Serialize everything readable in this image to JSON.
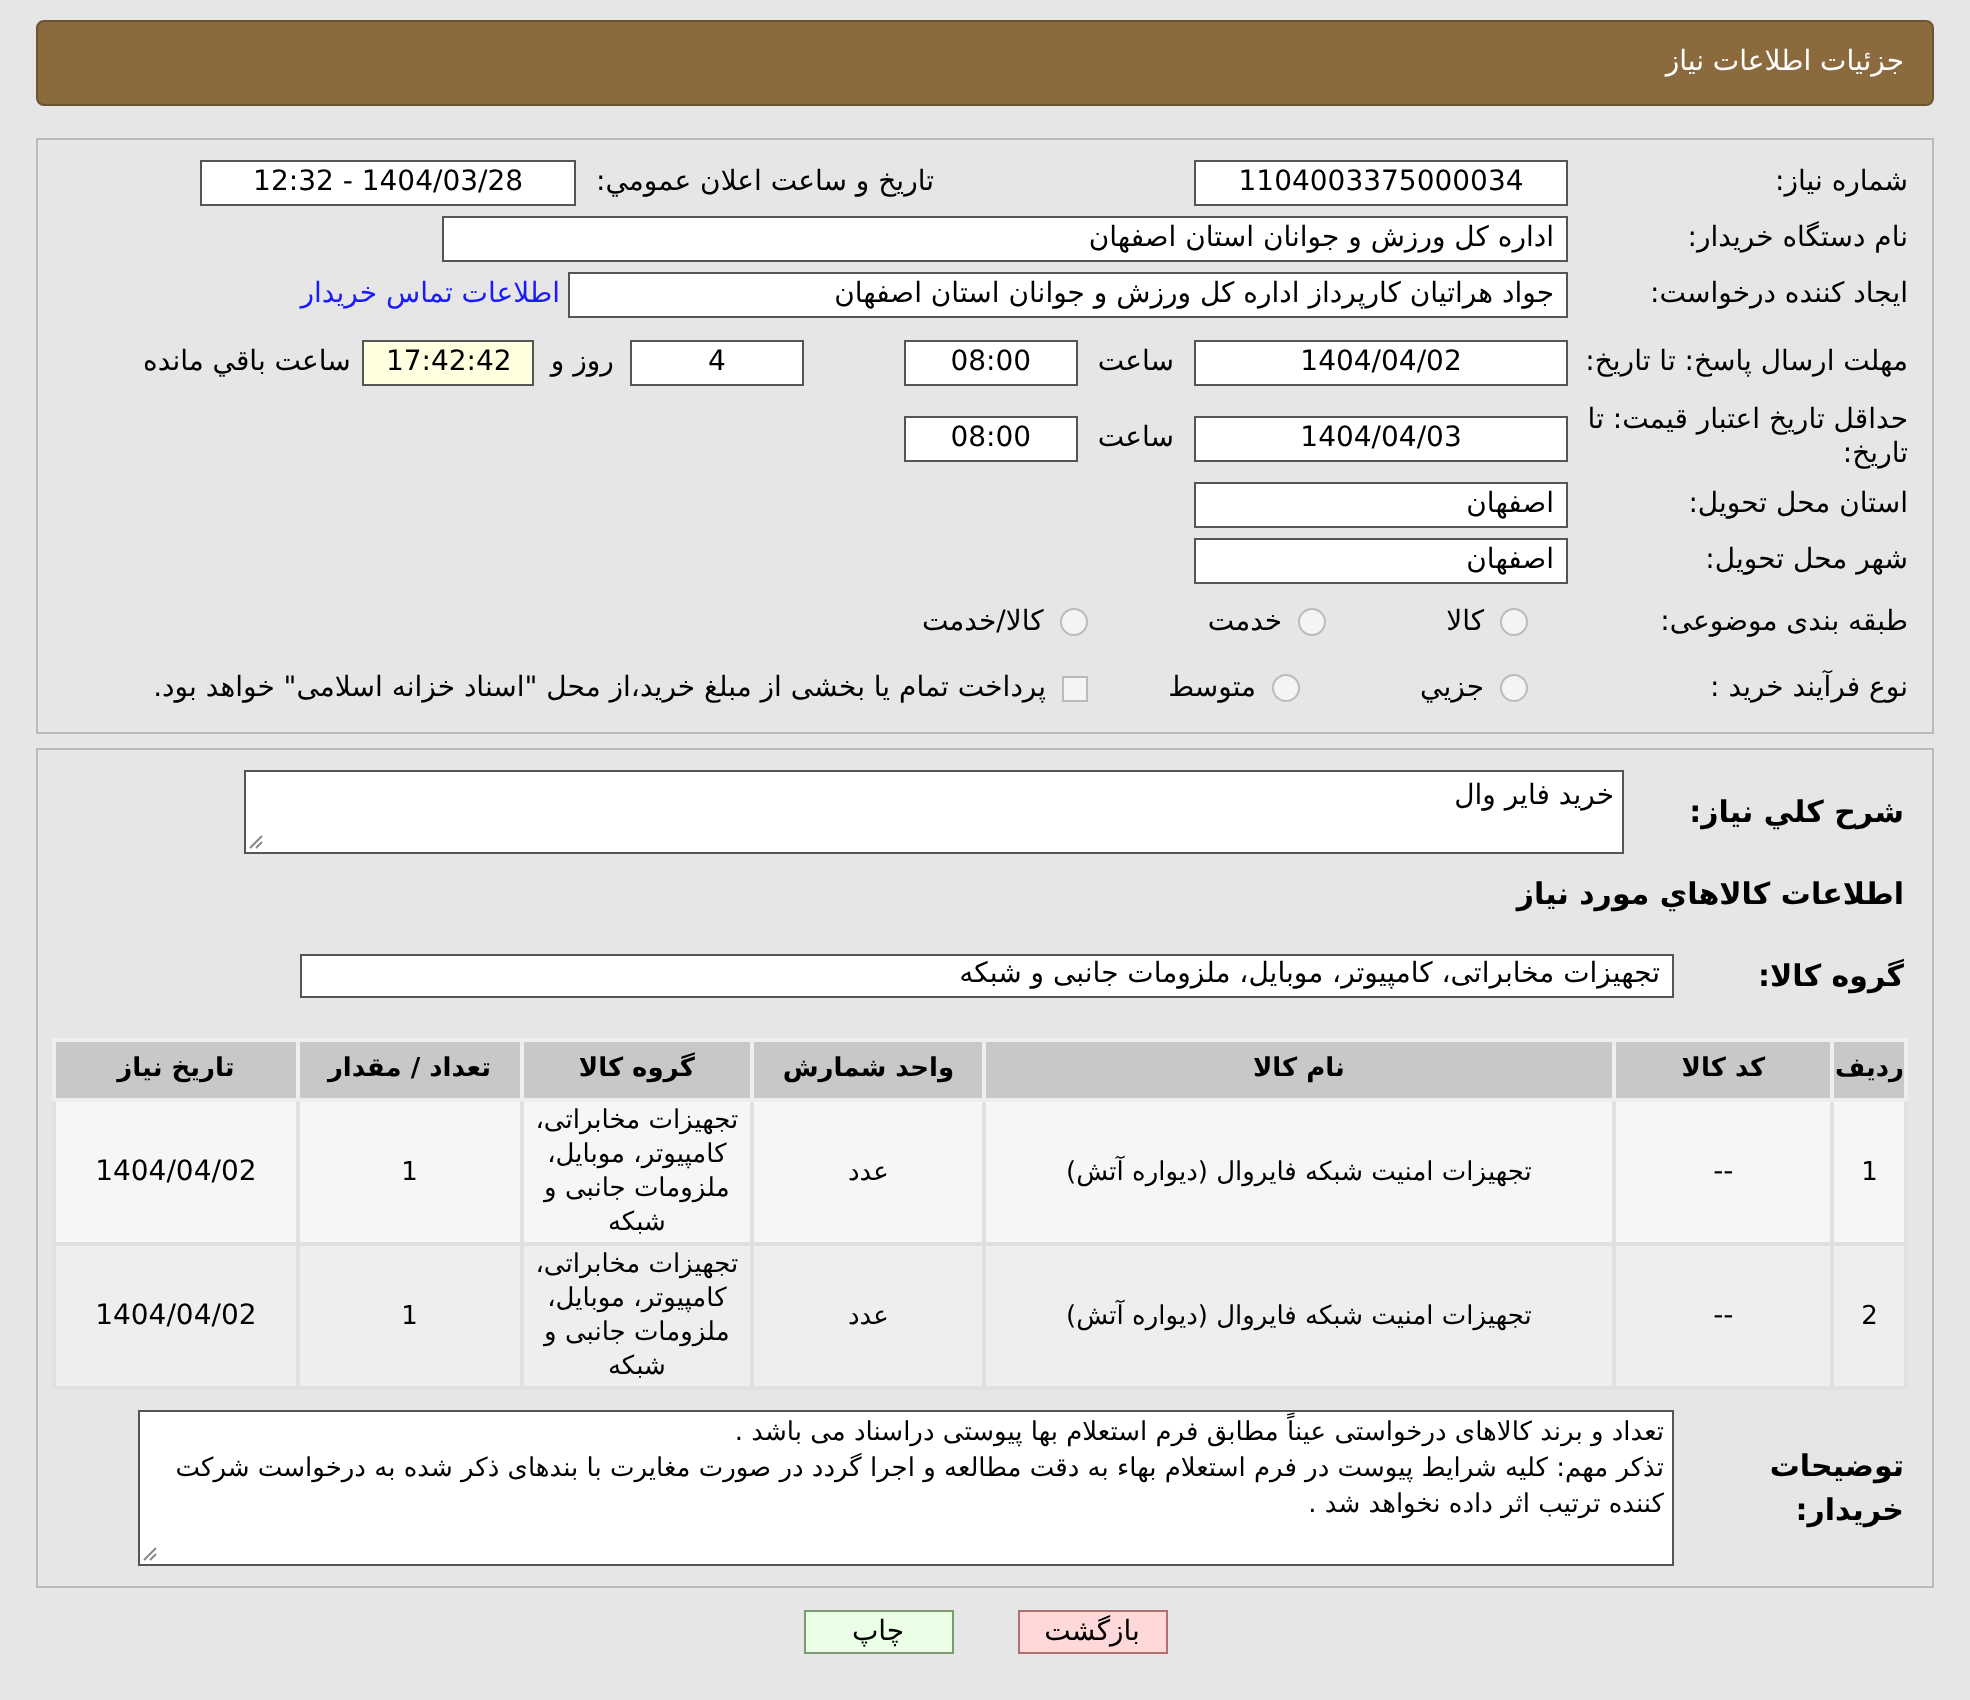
{
  "header": {
    "title": "جزئیات اطلاعات نیاز"
  },
  "need_number": {
    "label": "شماره نیاز:",
    "value": "1104003375000034"
  },
  "announce": {
    "label": "تاريخ و ساعت اعلان عمومي:",
    "value": "1404/03/28 - 12:32"
  },
  "buyer": {
    "label": "نام دستگاه خریدار:",
    "value": "اداره کل ورزش و جوانان استان اصفهان"
  },
  "creator": {
    "label": "ایجاد کننده درخواست:",
    "value": "جواد هراتیان کارپرداز اداره کل ورزش و جوانان استان اصفهان",
    "link": "اطلاعات تماس خریدار"
  },
  "deadline": {
    "label": "مهلت ارسال پاسخ: تا تاریخ:",
    "date": "1404/04/02",
    "time_label": "ساعت",
    "time": "08:00",
    "days": "4",
    "days_label": "روز و",
    "remaining": "17:42:42",
    "remaining_label": "ساعت باقي مانده"
  },
  "validity": {
    "label": "حداقل تاریخ اعتبار قیمت: تا تاریخ:",
    "date": "1404/04/03",
    "time_label": "ساعت",
    "time": "08:00"
  },
  "province": {
    "label": "استان محل تحویل:",
    "value": "اصفهان"
  },
  "city": {
    "label": "شهر محل تحویل:",
    "value": "اصفهان"
  },
  "category": {
    "label": "طبقه بندی موضوعی:",
    "options": [
      {
        "label": "کالا",
        "selected": false
      },
      {
        "label": "خدمت",
        "selected": false
      },
      {
        "label": "کالا/خدمت",
        "selected": false
      }
    ]
  },
  "process": {
    "label": "نوع فرآیند خرید :",
    "options": [
      {
        "label": "جزيي",
        "selected": false
      },
      {
        "label": "متوسط",
        "selected": false
      }
    ],
    "note": {
      "label": "پرداخت تمام یا بخشی از مبلغ خرید،از محل \"اسناد خزانه اسلامی\" خواهد بود.",
      "checked": false
    }
  },
  "description": {
    "label": "شرح کلي نياز:",
    "value": "خرید فایر وال"
  },
  "goods_title": "اطلاعات کالاهاي مورد نياز",
  "group": {
    "label": "گروه کالا:",
    "value": "تجهیزات مخابراتی، کامپیوتر، موبایل، ملزومات جانبی و شبکه"
  },
  "table": {
    "columns": [
      "رديف",
      "کد کالا",
      "نام کالا",
      "واحد شمارش",
      "گروه کالا",
      "تعداد / مقدار",
      "تاریخ نیاز"
    ],
    "rows": [
      [
        "1",
        "--",
        "تجهیزات امنیت شبکه فایروال (دیواره آتش)",
        "عدد",
        "تجهیزات مخابراتی، کامپیوتر، موبایل، ملزومات جانبی و شبکه",
        "1",
        "1404/04/02"
      ],
      [
        "2",
        "--",
        "تجهیزات امنیت شبکه فایروال (دیواره آتش)",
        "عدد",
        "تجهیزات مخابراتی، کامپیوتر، موبایل، ملزومات جانبی و شبکه",
        "1",
        "1404/04/02"
      ]
    ]
  },
  "notes": {
    "label": "توضیحات خریدار:",
    "lines": [
      "تعداد و برند کالاهای درخواستی عیناً مطابق فرم استعلام بها پیوستی دراسناد می باشد .",
      "تذکر مهم: کلیه شرایط پیوست در فرم استعلام بهاء به دقت مطالعه و اجرا گردد در صورت مغایرت با بندهای ذکر شده به درخواست شرکت کننده ترتیب اثر داده نخواهد شد ."
    ]
  },
  "buttons": [
    {
      "kind": "back",
      "label": "بازگشت"
    },
    {
      "kind": "print",
      "label": "چاپ"
    }
  ]
}
